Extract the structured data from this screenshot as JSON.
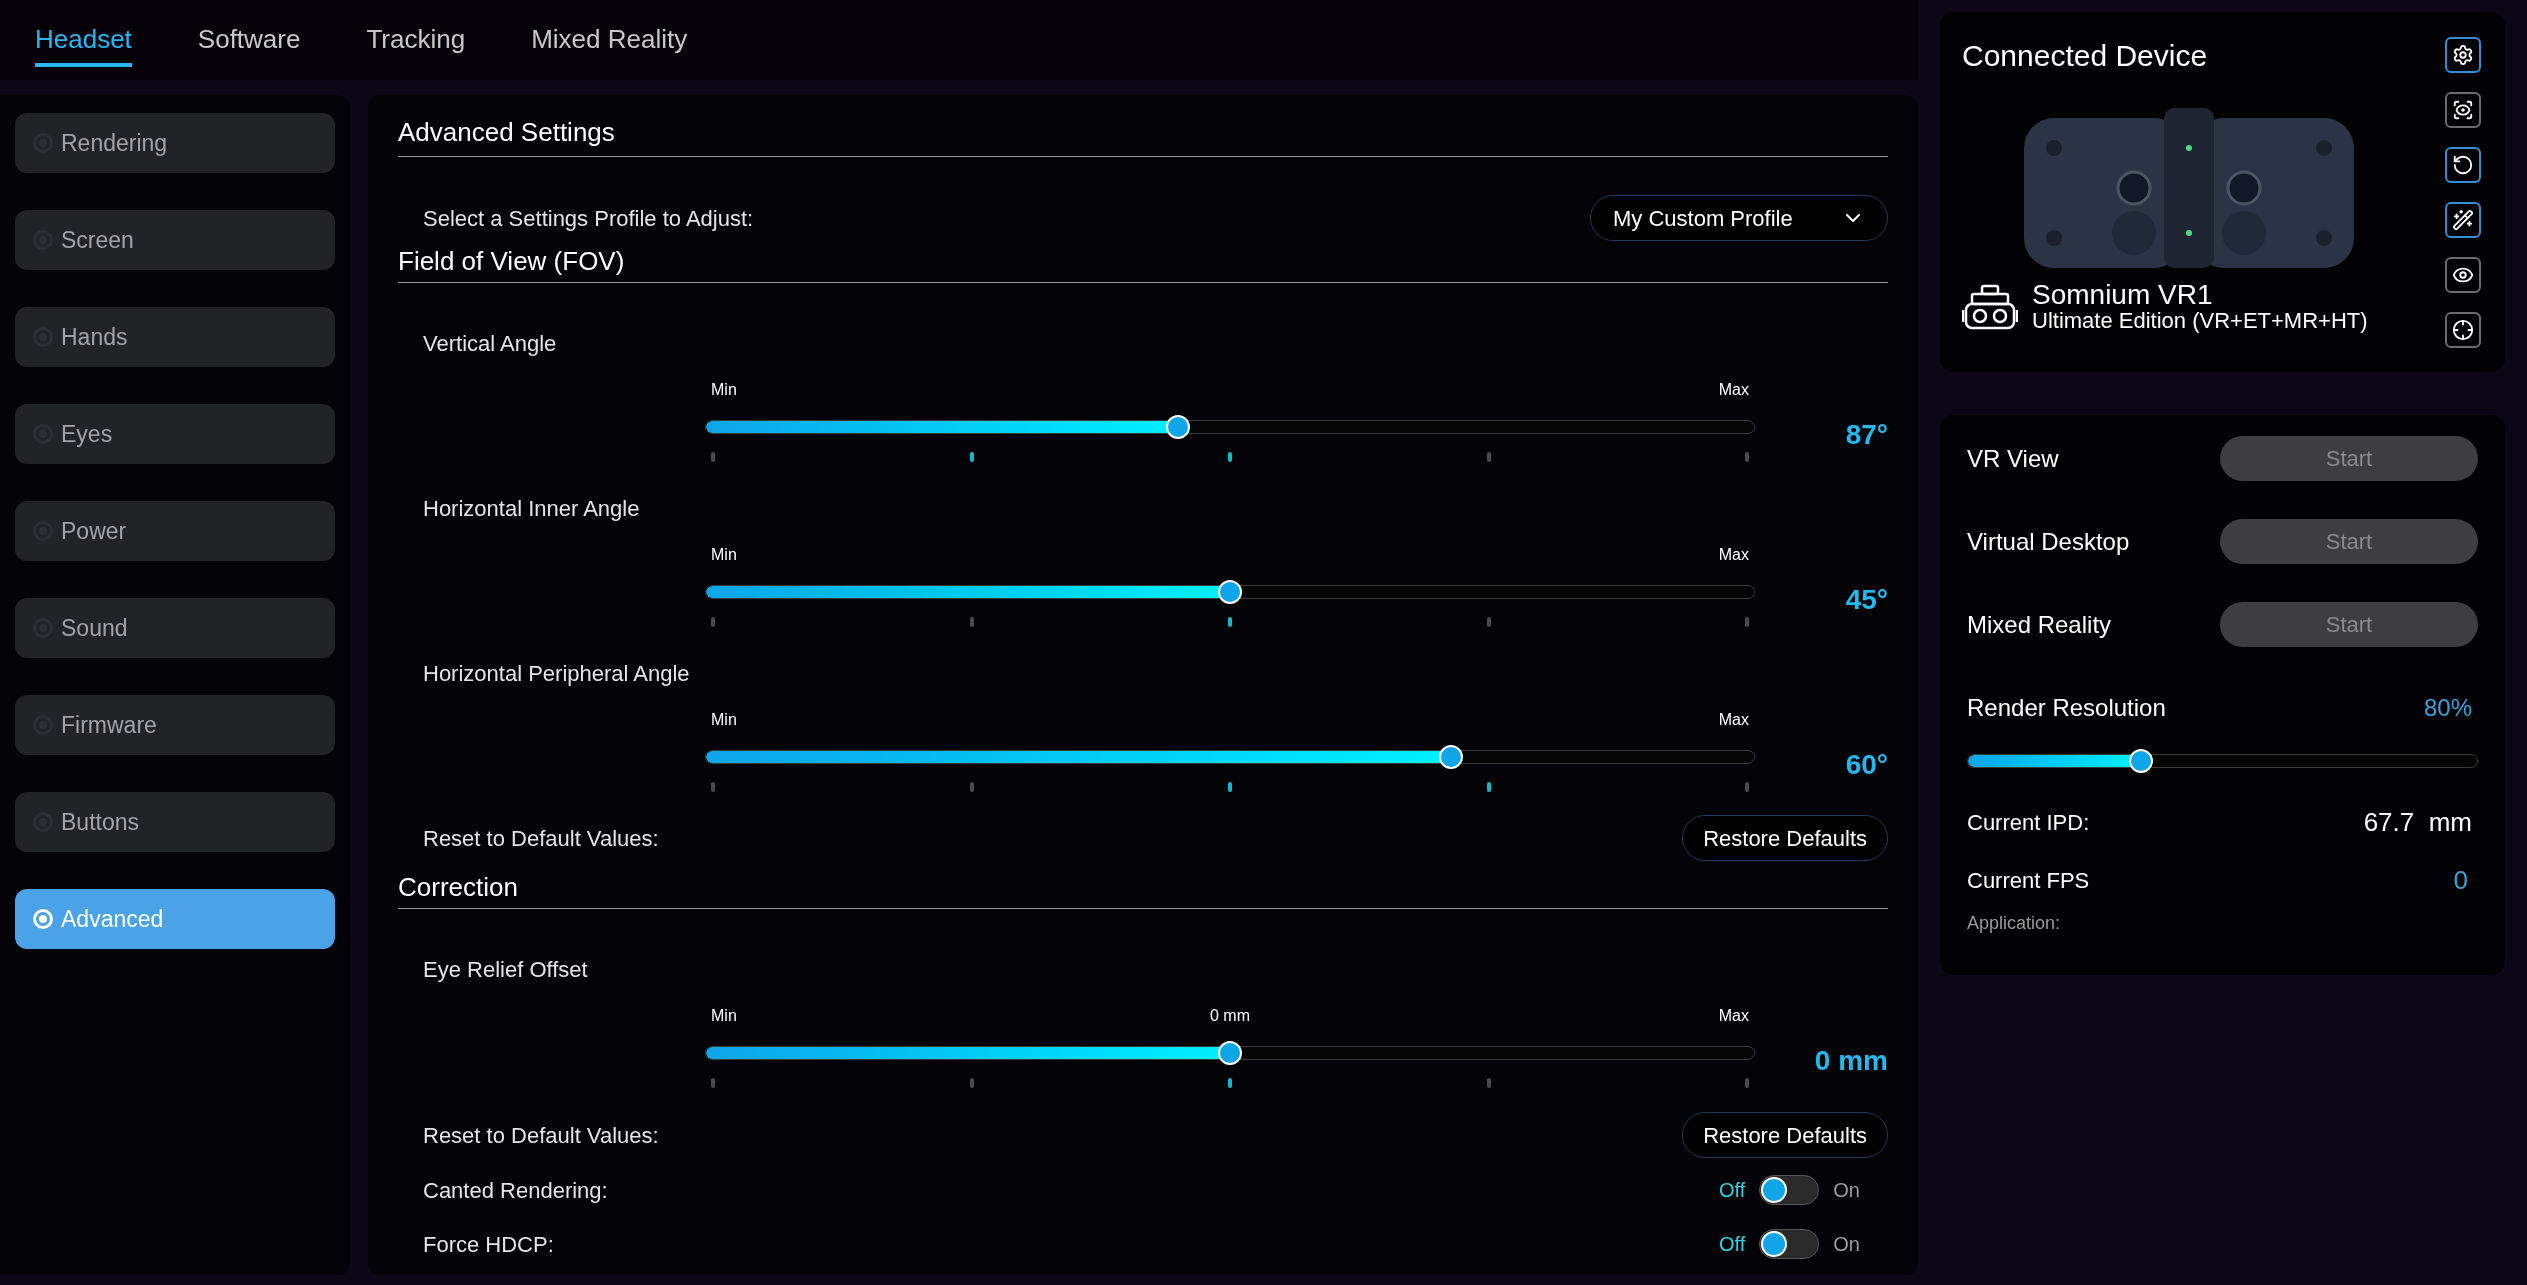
{
  "tabs": [
    {
      "label": "Headset",
      "selected": true
    },
    {
      "label": "Software",
      "selected": false
    },
    {
      "label": "Tracking",
      "selected": false
    },
    {
      "label": "Mixed Reality",
      "selected": false
    }
  ],
  "sidebar": {
    "items": [
      {
        "label": "Rendering",
        "selected": false
      },
      {
        "label": "Screen",
        "selected": false
      },
      {
        "label": "Hands",
        "selected": false
      },
      {
        "label": "Eyes",
        "selected": false
      },
      {
        "label": "Power",
        "selected": false
      },
      {
        "label": "Sound",
        "selected": false
      },
      {
        "label": "Firmware",
        "selected": false
      },
      {
        "label": "Buttons",
        "selected": false
      },
      {
        "label": "Advanced",
        "selected": true
      }
    ]
  },
  "main": {
    "title": "Advanced Settings",
    "profile": {
      "label": "Select a Settings Profile to Adjust:",
      "value": "My Custom Profile"
    },
    "fov": {
      "title": "Field of View (FOV)",
      "sliders": [
        {
          "label": "Vertical Angle",
          "min_label": "Min",
          "max_label": "Max",
          "level": 0.45,
          "reading": "87°",
          "ticks": [
            {
              "highlighted": false
            },
            {
              "highlighted": true
            },
            {
              "highlighted": true
            },
            {
              "highlighted": false
            },
            {
              "highlighted": false
            }
          ]
        },
        {
          "label": "Horizontal Inner Angle",
          "min_label": "Min",
          "max_label": "Max",
          "level": 0.5,
          "reading": "45°",
          "ticks": [
            {
              "highlighted": false
            },
            {
              "highlighted": false
            },
            {
              "highlighted": true
            },
            {
              "highlighted": false
            },
            {
              "highlighted": false
            }
          ]
        },
        {
          "label": "Horizontal Peripheral Angle",
          "min_label": "Min",
          "max_label": "Max",
          "level": 0.71,
          "reading": "60°",
          "ticks": [
            {
              "highlighted": false
            },
            {
              "highlighted": false
            },
            {
              "highlighted": true
            },
            {
              "highlighted": true
            },
            {
              "highlighted": false
            }
          ]
        }
      ],
      "reset": {
        "label": "Reset to Default Values:",
        "button": "Restore Defaults"
      }
    },
    "correction": {
      "title": "Correction",
      "sliders": [
        {
          "label": "Eye Relief Offset",
          "min_label": "Min",
          "mid_label": "0 mm",
          "max_label": "Max",
          "level": 0.5,
          "reading": "0 mm",
          "ticks": [
            {
              "highlighted": false
            },
            {
              "highlighted": false
            },
            {
              "highlighted": true
            },
            {
              "highlighted": false
            },
            {
              "highlighted": false
            }
          ]
        }
      ],
      "reset": {
        "label": "Reset to Default Values:",
        "button": "Restore Defaults"
      },
      "toggles": [
        {
          "label": "Canted Rendering:",
          "off_label": "Off",
          "on_label": "On",
          "on": false
        },
        {
          "label": "Force HDCP:",
          "off_label": "Off",
          "on_label": "On",
          "on": false
        }
      ]
    }
  },
  "device": {
    "title": "Connected Device",
    "name": "Somnium VR1",
    "edition": "Ultimate Edition (VR+ET+MR+HT)",
    "tools": [
      {
        "kind": "settings",
        "highlighted": true
      },
      {
        "kind": "eye-scan",
        "highlighted": false
      },
      {
        "kind": "reset",
        "highlighted": true
      },
      {
        "kind": "wand",
        "highlighted": true
      },
      {
        "kind": "eye",
        "highlighted": false
      },
      {
        "kind": "target",
        "highlighted": false
      }
    ]
  },
  "controls": {
    "launchers": [
      {
        "label": "VR View",
        "button": "Start",
        "disabled": true
      },
      {
        "label": "Virtual Desktop",
        "button": "Start",
        "disabled": true
      },
      {
        "label": "Mixed Reality",
        "button": "Start",
        "disabled": true
      }
    ],
    "render_resolution": {
      "label": "Render Resolution",
      "reading": "80%",
      "level": 0.34
    },
    "ipd": {
      "label": "Current IPD:",
      "value": "67.7  mm"
    },
    "fps": {
      "label": "Current FPS",
      "value": "0"
    },
    "application": {
      "label": "Application:"
    }
  }
}
